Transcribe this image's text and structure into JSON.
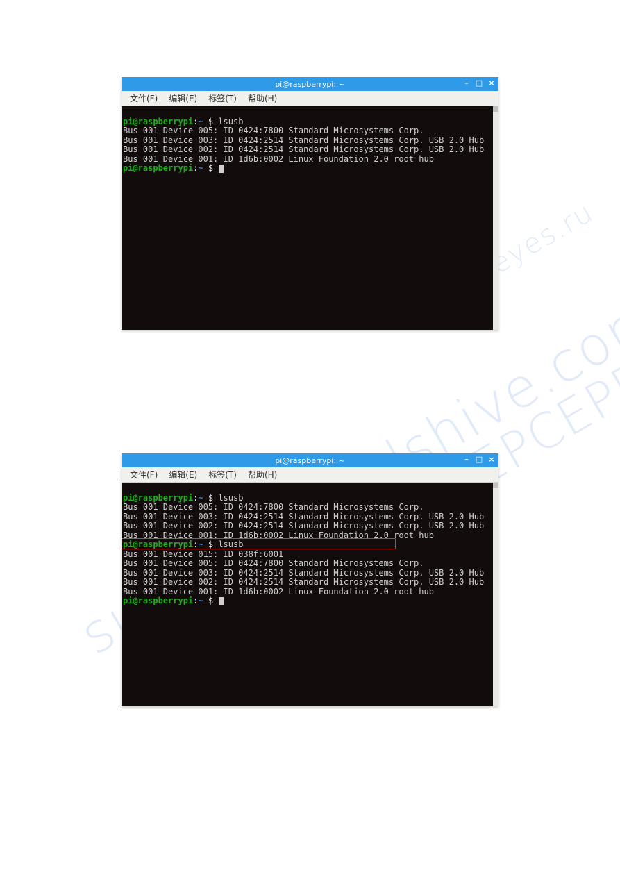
{
  "window": {
    "title": "pi@raspberrypi: ~",
    "controls": {
      "min": "–",
      "max": "□",
      "close": "×"
    }
  },
  "menu": {
    "file": "文件(F)",
    "edit": "编辑(E)",
    "tabs": "标签(T)",
    "help": "帮助(H)"
  },
  "prompt": {
    "user_host": "pi@raspberrypi",
    "sep": ":",
    "cwd": "~",
    "dollar": "$"
  },
  "commands": {
    "lsusb": "lsusb"
  },
  "terminal1": {
    "lines": [
      "Bus 001 Device 005: ID 0424:7800 Standard Microsystems Corp.",
      "Bus 001 Device 003: ID 0424:2514 Standard Microsystems Corp. USB 2.0 Hub",
      "Bus 001 Device 002: ID 0424:2514 Standard Microsystems Corp. USB 2.0 Hub",
      "Bus 001 Device 001: ID 1d6b:0002 Linux Foundation 2.0 root hub"
    ]
  },
  "terminal2": {
    "lines_block1": [
      "Bus 001 Device 005: ID 0424:7800 Standard Microsystems Corp.",
      "Bus 001 Device 003: ID 0424:2514 Standard Microsystems Corp. USB 2.0 Hub",
      "Bus 001 Device 002: ID 0424:2514 Standard Microsystems Corp. USB 2.0 Hub",
      "Bus 001 Device 001: ID 1d6b:0002 Linux Foundation 2.0 root hub"
    ],
    "highlighted_line": "Bus 001 Device 015: ID 038f:6001",
    "lines_block2": [
      "Bus 001 Device 005: ID 0424:7800 Standard Microsystems Corp.",
      "Bus 001 Device 003: ID 0424:2514 Standard Microsystems Corp. USB 2.0 Hub",
      "Bus 001 Device 002: ID 0424:2514 Standard Microsystems Corp. USB 2.0 Hub",
      "Bus 001 Device 001: ID 1d6b:0002 Linux Foundation 2.0 root hub"
    ]
  },
  "watermarks": {
    "w1": "supermanualshive.com",
    "w2": "СУПЕРСЕРВИС",
    "w3": "eyes.ru"
  }
}
